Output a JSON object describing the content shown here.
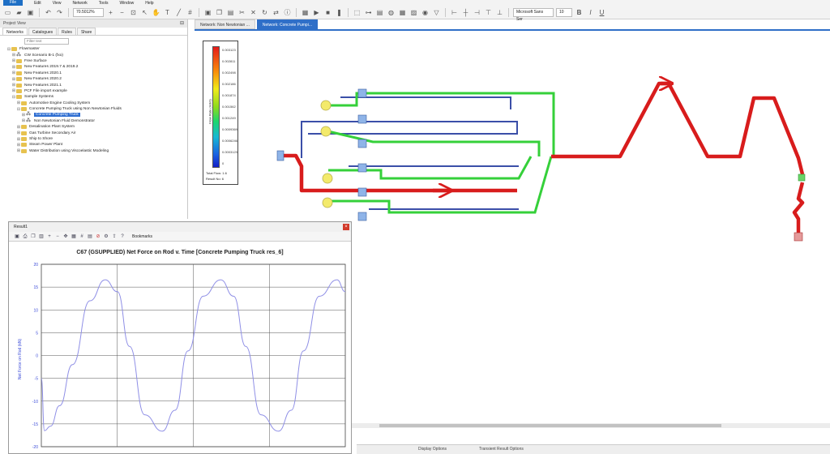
{
  "menu": {
    "file": "File",
    "items": [
      "Edit",
      "View",
      "Network",
      "Tools",
      "Window",
      "Help"
    ]
  },
  "toolbar": {
    "zoom": "70.5012%",
    "font_name": "Microsoft Sans Ser",
    "font_size": "10"
  },
  "project_view": {
    "title": "Project View",
    "tabs": [
      "Networks",
      "Catalogues",
      "Rules",
      "Share"
    ],
    "search_placeholder": "Filter text",
    "tree": [
      {
        "label": "Flowmaster",
        "level": 0,
        "kind": "folder",
        "exp": "⊟"
      },
      {
        "label": "CW Scenario B-1 (fxo)",
        "level": 1,
        "kind": "network",
        "exp": "⊞"
      },
      {
        "label": "Free Surface",
        "level": 1,
        "kind": "folder",
        "exp": "⊞"
      },
      {
        "label": "New Features 2019.7 & 2019.2",
        "level": 1,
        "kind": "folder",
        "exp": "⊞"
      },
      {
        "label": "New Features 2020.1",
        "level": 1,
        "kind": "folder",
        "exp": "⊞"
      },
      {
        "label": "New Features 2020.2",
        "level": 1,
        "kind": "folder",
        "exp": "⊞"
      },
      {
        "label": "New Features 2021.1",
        "level": 1,
        "kind": "folder",
        "exp": "⊞"
      },
      {
        "label": "PCF File import example",
        "level": 1,
        "kind": "folder",
        "exp": "⊞"
      },
      {
        "label": "Sample Systems",
        "level": 1,
        "kind": "folder",
        "exp": "⊟"
      },
      {
        "label": "Automotive Engine Cooling System",
        "level": 2,
        "kind": "folder",
        "exp": "⊞"
      },
      {
        "label": "Concrete Pumping Truck using Non Newtonian Fluids",
        "level": 2,
        "kind": "folder",
        "exp": "⊟"
      },
      {
        "label": "Concrete Pumping Truck",
        "level": 3,
        "kind": "network",
        "exp": "⊞",
        "selected": true
      },
      {
        "label": "Non Newtonian Fluid Demonstrator",
        "level": 3,
        "kind": "network",
        "exp": "⊞"
      },
      {
        "label": "Desalination Plant System",
        "level": 2,
        "kind": "folder",
        "exp": "⊞"
      },
      {
        "label": "Gas Turbine Secondary Air",
        "level": 2,
        "kind": "folder",
        "exp": "⊞"
      },
      {
        "label": "Ship to Shore",
        "level": 2,
        "kind": "folder",
        "exp": "⊞"
      },
      {
        "label": "Steam Power Plant",
        "level": 2,
        "kind": "folder",
        "exp": "⊞"
      },
      {
        "label": "Water Distribution using Viscoelastic Modeling",
        "level": 2,
        "kind": "folder",
        "exp": "⊞"
      }
    ]
  },
  "doc_tabs": [
    "Network: Non Newtonian ...",
    "Network: Concrete Pumpi..."
  ],
  "legend": {
    "title": "Flow Rate (m3/s)",
    "values": [
      "0.003123",
      "0.002811",
      "0.002498",
      "0.002186",
      "0.001874",
      "0.001562",
      "0.001249",
      "0.0009369",
      "0.0006246",
      "0.0003123",
      "0"
    ],
    "total_flow": "Total Flow: 1.6",
    "result_no": "Result No: 6"
  },
  "bottom_tabs": [
    "Display Options",
    "Transient Result Options"
  ],
  "result": {
    "window_title": "Result1",
    "close": "×",
    "bookmarks": "Bookmarks",
    "chart_title": "C67 (GSUPPLIED) Net Force on Rod v. Time [Concrete Pumping Truck res_6]"
  },
  "chart_data": {
    "type": "line",
    "title": "C67 (GSUPPLIED) Net Force on Rod v. Time [Concrete Pumping Truck res_6]",
    "xlabel": "",
    "ylabel": "Net Force on Rod (kN)",
    "ylim": [
      -20,
      20
    ],
    "yticks": [
      20,
      15,
      10,
      5,
      0,
      -5,
      -10,
      -15,
      -20
    ],
    "xlim": [
      0,
      40
    ],
    "series": [
      {
        "x": [
          0,
          0.4,
          1.2,
          2.4,
          4.1,
          6.4,
          8.4,
          10.0,
          11.6,
          13.6,
          15.9,
          17.6,
          19.3,
          21.3,
          23.6,
          25.3,
          26.9,
          28.9,
          31.2,
          32.9,
          34.5,
          36.6,
          38.9,
          40
        ],
        "y": [
          -5,
          -16.5,
          -15.5,
          -11,
          -2,
          12,
          16.6,
          14,
          2,
          -13,
          -16.6,
          -12,
          1,
          13,
          16.6,
          13,
          2,
          -13,
          -16.6,
          -12,
          1,
          13,
          16.6,
          14
        ],
        "color": "#8f8fe6"
      }
    ],
    "grid": true
  },
  "colors": {
    "accent": "#2f6fc8",
    "pipe_red": "#d81c1c",
    "pipe_green": "#35d03a",
    "pipe_blue": "#3b4fa8"
  }
}
